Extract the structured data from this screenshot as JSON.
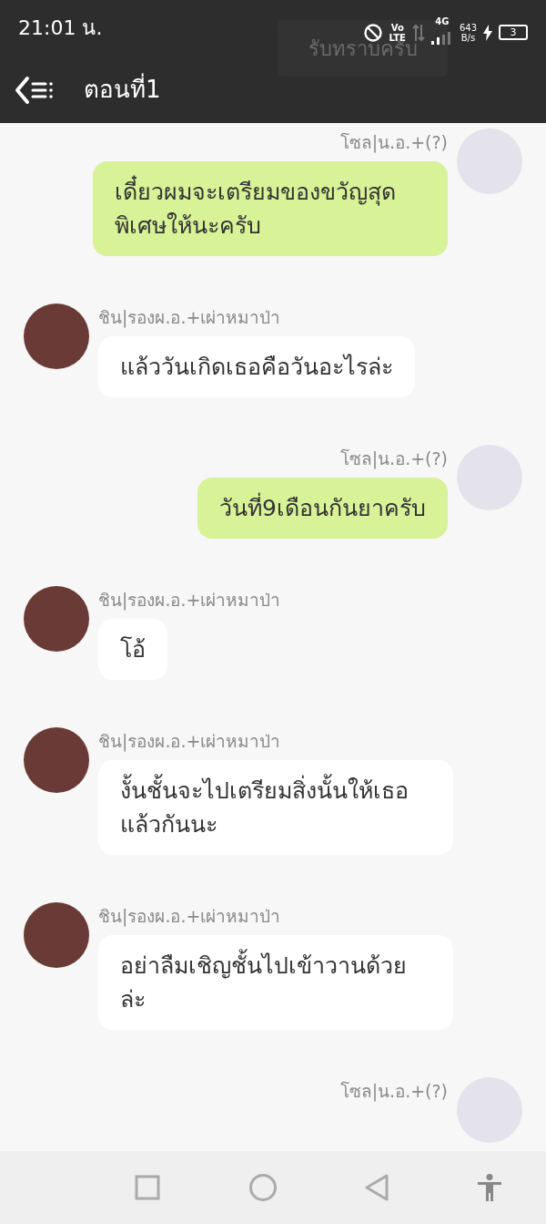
{
  "status_bar": {
    "time": "21:01 น.",
    "volte_top": "Vo",
    "volte_bottom": "LTE",
    "network": "4G",
    "speed_value": "643",
    "speed_unit": "B/s",
    "battery": "3"
  },
  "header": {
    "title": "ตอนที่1",
    "behind_message": "รับทราบครับ"
  },
  "messages": [
    {
      "kind": "sent",
      "name": "โซล|น.อ.+(?)",
      "text": "เดี๋ยวผมจะเตรียมของขวัญสุดพิเศษให้นะครับ"
    },
    {
      "kind": "received",
      "name": "ชิน|รองผ.อ.+เผ่าหมาป่า",
      "text": "แล้ววันเกิดเธอคือวันอะไรล่ะ"
    },
    {
      "kind": "sent",
      "name": "โซล|น.อ.+(?)",
      "text": "วันที่9เดือนกันยาครับ"
    },
    {
      "kind": "received",
      "name": "ชิน|รองผ.อ.+เผ่าหมาป่า",
      "text": "โอ้"
    },
    {
      "kind": "received",
      "name": "ชิน|รองผ.อ.+เผ่าหมาป่า",
      "text": "งั้นชั้นจะไปเตรียมสิ่งนั้นให้เธอแล้วกันนะ"
    },
    {
      "kind": "received",
      "name": "ชิน|รองผ.อ.+เผ่าหมาป่า",
      "text": "อย่าลืมเชิญชั้นไปเข้าวานด้วยล่ะ"
    },
    {
      "kind": "sent",
      "name": "โซล|น.อ.+(?)"
    }
  ]
}
